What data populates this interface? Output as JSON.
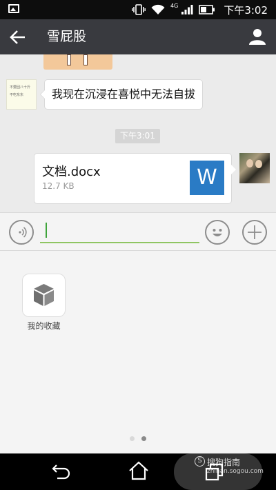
{
  "status_bar": {
    "network": "4G",
    "time": "下午3:02"
  },
  "header": {
    "title": "雪屁股"
  },
  "chat": {
    "incoming_avatar_lines": [
      "不要回八十斤",
      "不吃东东"
    ],
    "incoming_message": "我现在沉浸在喜悦中无法自拔",
    "timestamp": "下午3:01",
    "file": {
      "name": "文档.docx",
      "size": "12.7 KB",
      "type_letter": "W",
      "icon_color": "#2a7bc5"
    }
  },
  "input_bar": {
    "value": "",
    "accent_color": "#8fc562"
  },
  "panel": {
    "favorites_label": "我的收藏",
    "page_count": 2,
    "current_page": 2
  },
  "watermark": {
    "main": "搜狗指南",
    "sub": "zhinan.sogou.com",
    "logo": "S"
  }
}
